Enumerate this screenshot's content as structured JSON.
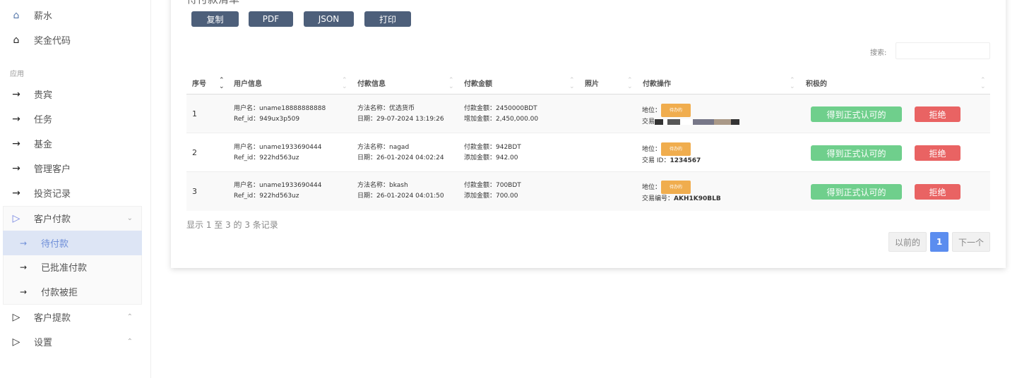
{
  "sidebar": {
    "top": [
      {
        "label": "薪水",
        "icon": "salary-home-icon"
      },
      {
        "label": "奖金代码",
        "icon": "home-icon"
      }
    ],
    "section": "应用",
    "items": [
      {
        "label": "贵宾"
      },
      {
        "label": "任务"
      },
      {
        "label": "基金"
      },
      {
        "label": "管理客户"
      },
      {
        "label": "投资记录"
      }
    ],
    "payments": {
      "label": "客户付款",
      "sub": [
        {
          "label": "待付款"
        },
        {
          "label": "已批准付款"
        },
        {
          "label": "付款被拒"
        }
      ]
    },
    "withdrawals": {
      "label": "客户提款"
    },
    "settings": {
      "label": "设置"
    }
  },
  "main": {
    "title": "待付款清单",
    "buttons": {
      "copy": "复制",
      "pdf": "PDF",
      "json": "JSON",
      "print": "打印"
    },
    "search_label": "搜索:",
    "search_value": "",
    "columns": [
      "序号",
      "用户信息",
      "付款信息",
      "付款金额",
      "照片",
      "付款操作",
      "积极的"
    ],
    "rows": [
      {
        "seq": "1",
        "user": "用户名：uname18888888888",
        "ref": "Ref_id：949ux3p509",
        "method": "方法名称：优选货币",
        "date": "日期：29-07-2024 13:19:26",
        "amount": "付款金额：2450000BDT",
        "added": "增加金额：2,450,000.00",
        "status_label": "地位：",
        "status": "待办的",
        "tx": "交易"
      },
      {
        "seq": "2",
        "user": "用户名：uname1933690444",
        "ref": "Ref_id：922hd563uz",
        "method": "方法名称：nagad",
        "date": "日期：26-01-2024 04:02:24",
        "amount": "付款金额：942BDT",
        "added": "添加金额：942.00",
        "status_label": "地位：",
        "status": "待办的",
        "tx": "交易 ID：",
        "tx_value": "1234567"
      },
      {
        "seq": "3",
        "user": "用户名：uname1933690444",
        "ref": "Ref_id：922hd563uz",
        "method": "方法名称：bkash",
        "date": "日期：26-01-2024 04:01:50",
        "amount": "付款金额：700BDT",
        "added": "添加金额：700.00",
        "status_label": "地位：",
        "status": "待办的",
        "tx": "交易编号：",
        "tx_value": "AKH1K90BLB"
      }
    ],
    "approve": "得到正式认可的",
    "reject": "拒绝",
    "info": "显示 1 至 3 的 3 条记录",
    "pagination": {
      "prev": "以前的",
      "page": "1",
      "next": "下一个"
    }
  }
}
